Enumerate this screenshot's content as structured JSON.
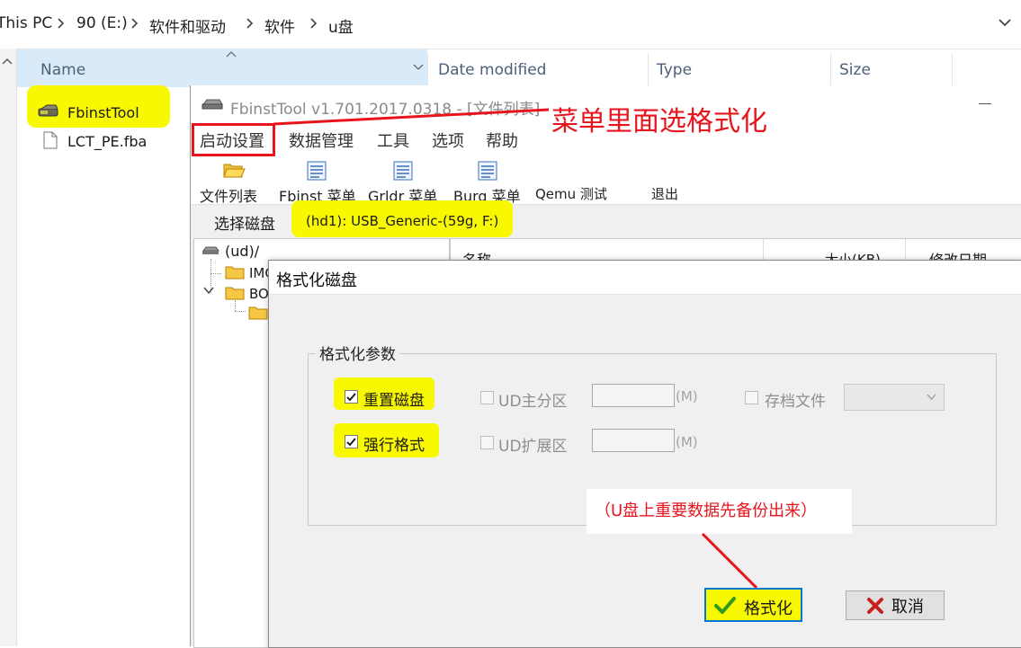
{
  "explorer": {
    "breadcrumbs": [
      "This PC",
      "90 (E:)",
      "软件和驱动",
      "软件",
      "u盘"
    ],
    "columns": {
      "name": "Name",
      "date": "Date modified",
      "type": "Type",
      "size": "Size"
    },
    "files": [
      {
        "name": "FbinstTool",
        "icon": "app-icon",
        "highlighted": true
      },
      {
        "name": "LCT_PE.fba",
        "icon": "file-icon",
        "highlighted": false
      }
    ]
  },
  "fbinst": {
    "title": "FbinstTool v1.701.2017.0318 - [文件列表]",
    "menu": [
      "启动设置",
      "数据管理",
      "工具",
      "选项",
      "帮助"
    ],
    "toolbar": [
      "文件列表",
      "Fbinst 菜单",
      "Grldr 菜单",
      "Burg 菜单",
      "Qemu 测试",
      "退出"
    ],
    "disk_label": "选择磁盘",
    "disk_value": "(hd1): USB_Generic-(59g, F:)",
    "tree": {
      "root": "(ud)/",
      "items": [
        "IMG",
        "BO"
      ]
    },
    "list_headers": [
      "名称",
      "大小(KB)",
      "修改日期"
    ]
  },
  "format_dialog": {
    "title": "格式化磁盘",
    "group_title": "格式化参数",
    "reset_disk": {
      "label": "重置磁盘",
      "checked": true
    },
    "force_format": {
      "label": "强行格式",
      "checked": true
    },
    "ud_primary": {
      "label": "UD主分区",
      "checked": false,
      "unit": "(M)",
      "value": ""
    },
    "ud_extended": {
      "label": "UD扩展区",
      "checked": false,
      "unit": "(M)",
      "value": ""
    },
    "archive": {
      "label": "存档文件",
      "checked": false,
      "value": ""
    },
    "format_button": "格式化",
    "cancel_button": "取消"
  },
  "annotations": {
    "menu_note": "菜单里面选格式化",
    "backup_note": "（U盘上重要数据先备份出来）"
  },
  "colors": {
    "highlight": "#f8f800",
    "annotation": "#e8141c",
    "accent": "#0078d7"
  }
}
